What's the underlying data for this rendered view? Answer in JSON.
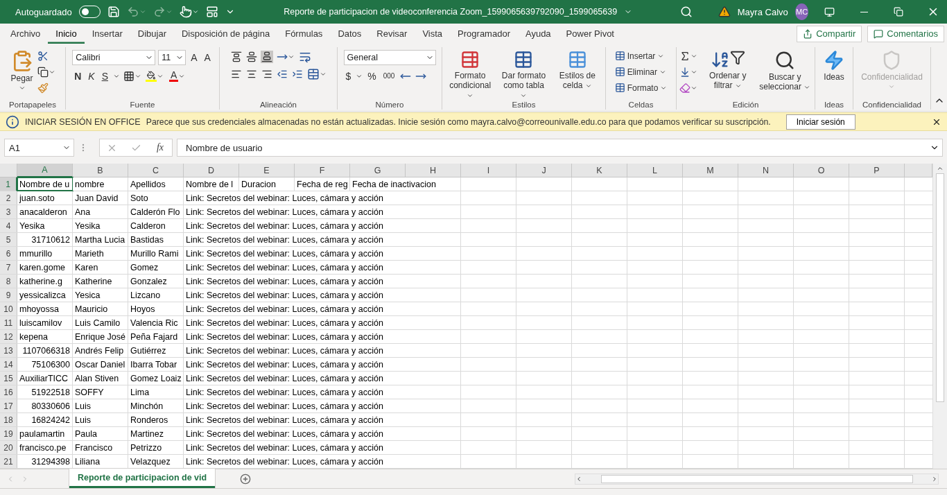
{
  "title_bar": {
    "autosave_label": "Autoguardado",
    "autosave_on": false,
    "title": "Reporte de participacion de videoconferencia Zoom_1599065639792090_1599065639",
    "user_name": "Mayra Calvo",
    "avatar_initials": "MC"
  },
  "menu_tabs": [
    {
      "label": "Archivo",
      "selected": false
    },
    {
      "label": "Inicio",
      "selected": true
    },
    {
      "label": "Insertar",
      "selected": false
    },
    {
      "label": "Dibujar",
      "selected": false
    },
    {
      "label": "Disposición de página",
      "selected": false
    },
    {
      "label": "Fórmulas",
      "selected": false
    },
    {
      "label": "Datos",
      "selected": false
    },
    {
      "label": "Revisar",
      "selected": false
    },
    {
      "label": "Vista",
      "selected": false
    },
    {
      "label": "Programador",
      "selected": false
    },
    {
      "label": "Ayuda",
      "selected": false
    },
    {
      "label": "Power Pivot",
      "selected": false
    }
  ],
  "share_button": "Compartir",
  "comments_button": "Comentarios",
  "ribbon": {
    "clipboard": {
      "label": "Portapapeles",
      "paste": "Pegar"
    },
    "font": {
      "label": "Fuente",
      "font_name": "Calibri",
      "font_size": "11",
      "grow": "A",
      "shrink": "A",
      "bold": "N",
      "italic": "K",
      "underline": "S",
      "font_color": "A"
    },
    "alignment": {
      "label": "Alineación"
    },
    "number": {
      "label": "Número",
      "format": "General",
      "currency": "$",
      "percent": "%",
      "thousands": "000"
    },
    "styles": {
      "label": "Estilos",
      "buttons": [
        "Formato condicional",
        "Dar formato como tabla",
        "Estilos de celda"
      ]
    },
    "cells": {
      "label": "Celdas",
      "buttons": [
        "Insertar",
        "Eliminar",
        "Formato"
      ]
    },
    "editing": {
      "label": "Edición",
      "buttons": [
        "Ordenar y filtrar",
        "Buscar y seleccionar"
      ]
    },
    "ideas": {
      "label": "Ideas",
      "button": "Ideas"
    },
    "sensitivity": {
      "label": "Confidencialidad",
      "button": "Confidencialidad",
      "disabled": true
    }
  },
  "message_bar": {
    "title": "INICIAR SESIÓN EN OFFICE",
    "text": "Parece que sus credenciales almacenadas no están actualizadas. Inicie sesión como mayra.calvo@correounivalle.edu.co para que podamos verificar su suscripción.",
    "button": "Iniciar sesión"
  },
  "formula_bar": {
    "name_box": "A1",
    "fx": "fx",
    "formula": "Nombre de usuario"
  },
  "sheet": {
    "columns": [
      {
        "label": "A",
        "selected": true
      },
      {
        "label": "B",
        "selected": false
      },
      {
        "label": "C",
        "selected": false
      },
      {
        "label": "D",
        "selected": false
      },
      {
        "label": "E",
        "selected": false
      },
      {
        "label": "F",
        "selected": false
      },
      {
        "label": "G",
        "selected": false
      },
      {
        "label": "H",
        "selected": false
      },
      {
        "label": "I",
        "selected": false
      },
      {
        "label": "J",
        "selected": false
      },
      {
        "label": "K",
        "selected": false
      },
      {
        "label": "L",
        "selected": false
      },
      {
        "label": "M",
        "selected": false
      },
      {
        "label": "N",
        "selected": false
      },
      {
        "label": "O",
        "selected": false
      },
      {
        "label": "P",
        "selected": false
      }
    ],
    "rows": [
      {
        "number": "1",
        "selected": true,
        "a_is_number": false,
        "cells": [
          "Nombre de u",
          "nombre",
          "Apellidos",
          "Nombre de l",
          "Duracion",
          "Fecha de reg",
          "Fecha de inactivacion"
        ]
      },
      {
        "number": "2",
        "selected": false,
        "a_is_number": false,
        "cells": [
          "juan.soto",
          "Juan David",
          "Soto",
          "Link: Secretos del webinar: Luces, cámara y acción"
        ]
      },
      {
        "number": "3",
        "selected": false,
        "a_is_number": false,
        "cells": [
          "anacalderon",
          "Ana",
          "Calderón Flo",
          "Link: Secretos del webinar: Luces, cámara y acción"
        ]
      },
      {
        "number": "4",
        "selected": false,
        "a_is_number": false,
        "cells": [
          "Yesika",
          "Yesika",
          "Calderon",
          "Link: Secretos del webinar: Luces, cámara y acción"
        ]
      },
      {
        "number": "5",
        "selected": false,
        "a_is_number": true,
        "cells": [
          "31710612",
          "Martha Lucia",
          "Bastidas",
          "Link: Secretos del webinar: Luces, cámara y acción"
        ]
      },
      {
        "number": "6",
        "selected": false,
        "a_is_number": false,
        "cells": [
          "mmurillo",
          "Marieth",
          "Murillo Rami",
          "Link: Secretos del webinar: Luces, cámara y acción"
        ]
      },
      {
        "number": "7",
        "selected": false,
        "a_is_number": false,
        "cells": [
          "karen.gome",
          "Karen",
          "Gomez",
          "Link: Secretos del webinar: Luces, cámara y acción"
        ]
      },
      {
        "number": "8",
        "selected": false,
        "a_is_number": false,
        "cells": [
          "katherine.g",
          "Katherine",
          "Gonzalez",
          "Link: Secretos del webinar: Luces, cámara y acción"
        ]
      },
      {
        "number": "9",
        "selected": false,
        "a_is_number": false,
        "cells": [
          "yessicalizca",
          "Yesica",
          "Lizcano",
          "Link: Secretos del webinar: Luces, cámara y acción"
        ]
      },
      {
        "number": "10",
        "selected": false,
        "a_is_number": false,
        "cells": [
          "mhoyossa",
          "Mauricio",
          "Hoyos",
          "Link: Secretos del webinar: Luces, cámara y acción"
        ]
      },
      {
        "number": "11",
        "selected": false,
        "a_is_number": false,
        "cells": [
          "luiscamilov",
          "Luis Camilo",
          "Valencia Ric",
          "Link: Secretos del webinar: Luces, cámara y acción"
        ]
      },
      {
        "number": "12",
        "selected": false,
        "a_is_number": false,
        "cells": [
          "kepena",
          "Enrique José",
          "Peña Fajard",
          "Link: Secretos del webinar: Luces, cámara y acción"
        ]
      },
      {
        "number": "13",
        "selected": false,
        "a_is_number": true,
        "cells": [
          "1107066318",
          "Andrés Felip",
          "Gutiérrez",
          "Link: Secretos del webinar: Luces, cámara y acción"
        ]
      },
      {
        "number": "14",
        "selected": false,
        "a_is_number": true,
        "cells": [
          "75106300",
          "Oscar Daniel",
          "Ibarra Tobar",
          "Link: Secretos del webinar: Luces, cámara y acción"
        ]
      },
      {
        "number": "15",
        "selected": false,
        "a_is_number": false,
        "cells": [
          "AuxiliarTICC",
          "Alan Stiven",
          "Gomez Loaiz",
          "Link: Secretos del webinar: Luces, cámara y acción"
        ]
      },
      {
        "number": "16",
        "selected": false,
        "a_is_number": true,
        "cells": [
          "51922518",
          "SOFFY",
          "Lima",
          "Link: Secretos del webinar: Luces, cámara y acción"
        ]
      },
      {
        "number": "17",
        "selected": false,
        "a_is_number": true,
        "cells": [
          "80330606",
          "Luis",
          "Minchón",
          "Link: Secretos del webinar: Luces, cámara y acción"
        ]
      },
      {
        "number": "18",
        "selected": false,
        "a_is_number": true,
        "cells": [
          "16824242",
          "Luis",
          "Ronderos",
          "Link: Secretos del webinar: Luces, cámara y acción"
        ]
      },
      {
        "number": "19",
        "selected": false,
        "a_is_number": false,
        "cells": [
          "paulamartin",
          "Paula",
          "Martinez",
          "Link: Secretos del webinar: Luces, cámara y acción"
        ]
      },
      {
        "number": "20",
        "selected": false,
        "a_is_number": false,
        "cells": [
          "francisco.pe",
          "Francisco",
          "Petrizzo",
          "Link: Secretos del webinar: Luces, cámara y acción"
        ]
      },
      {
        "number": "21",
        "selected": false,
        "a_is_number": true,
        "cells": [
          "31294398",
          "Liliana",
          "Velazquez",
          "Link: Secretos del webinar: Luces, cámara y acción"
        ]
      }
    ]
  },
  "sheet_tabs": [
    {
      "label": "Reporte de participacion de vid",
      "selected": true
    }
  ]
}
